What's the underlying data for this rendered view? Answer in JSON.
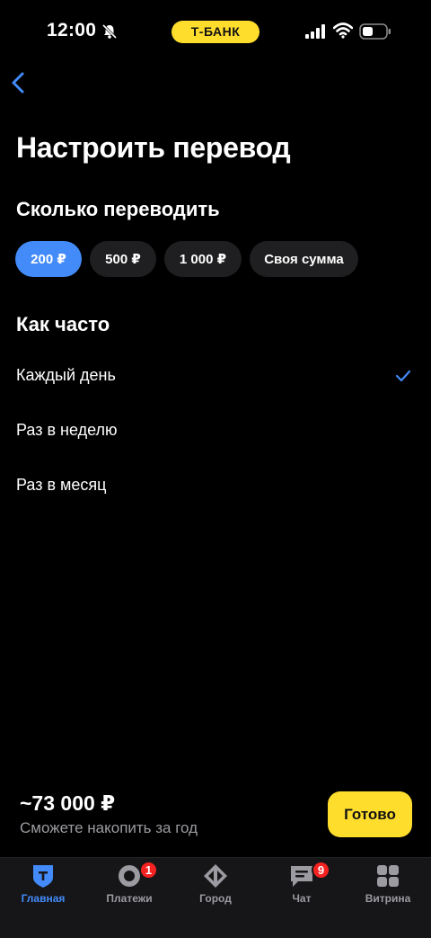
{
  "status_bar": {
    "time": "12:00",
    "carrier_pill": "Т-БАНК",
    "icons": [
      "bell-off-icon",
      "signal-icon",
      "wifi-icon",
      "battery-icon"
    ]
  },
  "header": {
    "back_icon": "chevron-left-icon",
    "title": "Настроить перевод"
  },
  "amount_section": {
    "title": "Сколько переводить",
    "chips": [
      {
        "label": "200 ₽",
        "selected": true
      },
      {
        "label": "500 ₽",
        "selected": false
      },
      {
        "label": "1 000 ₽",
        "selected": false
      },
      {
        "label": "Своя сумма",
        "selected": false
      }
    ]
  },
  "frequency_section": {
    "title": "Как часто",
    "options": [
      {
        "label": "Каждый день",
        "selected": true
      },
      {
        "label": "Раз в неделю",
        "selected": false
      },
      {
        "label": "Раз в месяц",
        "selected": false
      }
    ]
  },
  "summary": {
    "amount": "~73 000 ₽",
    "caption": "Сможете накопить за год",
    "done_button": "Готово"
  },
  "tab_bar": {
    "tabs": [
      {
        "label": "Главная",
        "icon": "home-shield-icon",
        "active": true
      },
      {
        "label": "Платежи",
        "icon": "payments-icon",
        "badge": "1"
      },
      {
        "label": "Город",
        "icon": "city-icon"
      },
      {
        "label": "Чат",
        "icon": "chat-icon",
        "badge": "9"
      },
      {
        "label": "Витрина",
        "icon": "showcase-grid-icon"
      }
    ]
  },
  "colors": {
    "accent_blue": "#428bf9",
    "brand_yellow": "#ffdd2d",
    "chip_bg": "#1f1f21",
    "badge_red": "#f52222",
    "muted_text": "#9b9ba1"
  }
}
